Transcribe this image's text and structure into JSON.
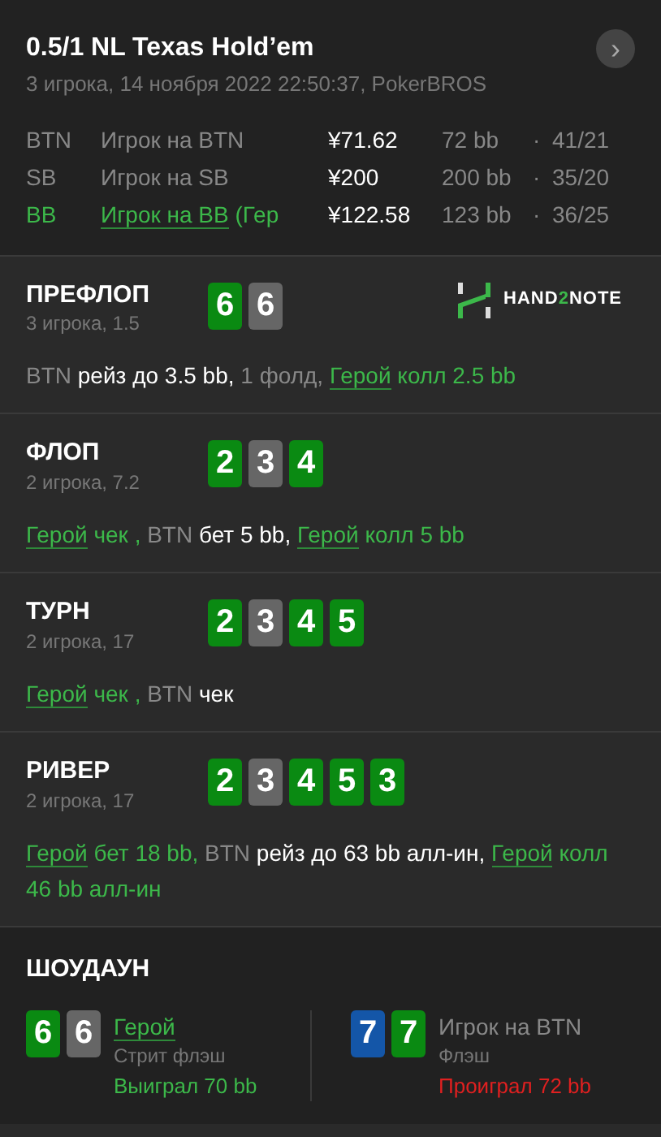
{
  "header": {
    "title": "0.5/1 NL Texas Hold’em",
    "subtitle": "3 игрока, 14 ноября 2022 22:50:37, PokerBROS",
    "next_button": "›"
  },
  "players": [
    {
      "position": "BTN",
      "name": "Игрок на BTN",
      "hero": false,
      "stack": "¥71.62",
      "bb": "72 bb",
      "separator": "·",
      "stats": "41/21"
    },
    {
      "position": "SB",
      "name": "Игрок на SB",
      "hero": false,
      "stack": "¥200",
      "bb": "200 bb",
      "separator": "·",
      "stats": "35/20"
    },
    {
      "position": "BB",
      "name": "Игрок на BB",
      "name_suffix": " (Гер",
      "hero": true,
      "stack": "¥122.58",
      "bb": "123 bb",
      "separator": "·",
      "stats": "36/25"
    }
  ],
  "logo": {
    "parts": [
      {
        "text": "HAND",
        "accent": false
      },
      {
        "text": "2",
        "accent": true
      },
      {
        "text": "NOTE",
        "accent": false
      }
    ]
  },
  "streets": [
    {
      "title": "ПРЕФЛОП",
      "info": "3 игрока, 1.5",
      "cards": [
        {
          "rank": "6",
          "color": "#0a8a12"
        },
        {
          "rank": "6",
          "color": "#666666"
        }
      ],
      "actions": [
        {
          "kind": "player",
          "text": "BTN"
        },
        {
          "kind": "action",
          "text": " рейз до 3.5 bb,"
        },
        {
          "kind": "info",
          "text": " 1 фолд, "
        },
        {
          "kind": "hero",
          "text": "Герой"
        },
        {
          "kind": "hero-action",
          "text": " колл 2.5 bb"
        }
      ]
    },
    {
      "title": "ФЛОП",
      "info": "2 игрока, 7.2",
      "cards": [
        {
          "rank": "2",
          "color": "#0a8a12"
        },
        {
          "rank": "3",
          "color": "#666666"
        },
        {
          "rank": "4",
          "color": "#0a8a12"
        }
      ],
      "actions": [
        {
          "kind": "hero",
          "text": "Герой"
        },
        {
          "kind": "hero-action",
          "text": " чек ,"
        },
        {
          "kind": "player",
          "text": " BTN"
        },
        {
          "kind": "action",
          "text": " бет 5 bb, "
        },
        {
          "kind": "hero",
          "text": "Герой"
        },
        {
          "kind": "hero-action",
          "text": " колл 5 bb"
        }
      ]
    },
    {
      "title": "ТУРН",
      "info": "2 игрока, 17",
      "cards": [
        {
          "rank": "2",
          "color": "#0a8a12"
        },
        {
          "rank": "3",
          "color": "#666666"
        },
        {
          "rank": "4",
          "color": "#0a8a12"
        },
        {
          "rank": "5",
          "color": "#0a8a12"
        }
      ],
      "actions": [
        {
          "kind": "hero",
          "text": "Герой"
        },
        {
          "kind": "hero-action",
          "text": " чек ,"
        },
        {
          "kind": "player",
          "text": " BTN"
        },
        {
          "kind": "action",
          "text": " чек"
        }
      ]
    },
    {
      "title": "РИВЕР",
      "info": "2 игрока, 17",
      "cards": [
        {
          "rank": "2",
          "color": "#0a8a12"
        },
        {
          "rank": "3",
          "color": "#666666"
        },
        {
          "rank": "4",
          "color": "#0a8a12"
        },
        {
          "rank": "5",
          "color": "#0a8a12"
        },
        {
          "rank": "3",
          "color": "#0a8a12"
        }
      ],
      "actions": [
        {
          "kind": "hero",
          "text": "Герой"
        },
        {
          "kind": "hero-action",
          "text": " бет 18 bb,"
        },
        {
          "kind": "player",
          "text": " BTN"
        },
        {
          "kind": "action",
          "text": " рейз до 63 bb алл-ин, "
        },
        {
          "kind": "hero",
          "text": "Герой"
        },
        {
          "kind": "hero-action",
          "text": " колл 46 bb алл-ин"
        }
      ]
    }
  ],
  "showdown": {
    "title": "ШОУДАУН",
    "players": [
      {
        "name": "Герой",
        "hero": true,
        "hand": "Стрит флэш",
        "result": "Выиграл 70 bb",
        "won": true,
        "cards": [
          {
            "rank": "6",
            "color": "#0a8a12"
          },
          {
            "rank": "6",
            "color": "#666666"
          }
        ]
      },
      {
        "name": "Игрок на BTN",
        "hero": false,
        "hand": "Флэш",
        "result": "Проиграл 72 bb",
        "won": false,
        "cards": [
          {
            "rank": "7",
            "color": "#1456a8"
          },
          {
            "rank": "7",
            "color": "#0a8a12"
          }
        ]
      }
    ]
  }
}
